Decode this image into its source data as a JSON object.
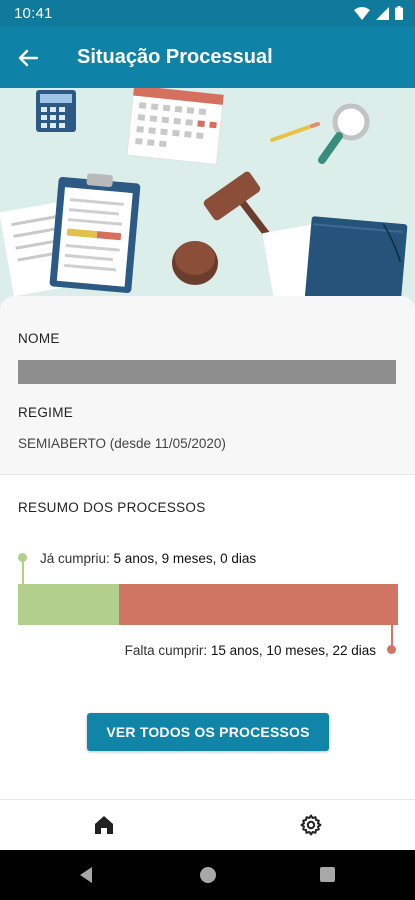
{
  "status_bar": {
    "time": "10:41"
  },
  "app_bar": {
    "title": "Situação Processual"
  },
  "colors": {
    "primary": "#0f82a8",
    "done": "#b3cf8c",
    "remaining": "#d07464"
  },
  "details": {
    "name_label": "NOME",
    "regime_label": "REGIME",
    "regime_value": "SEMIABERTO (desde 11/05/2020)"
  },
  "summary": {
    "title": "RESUMO DOS PROCESSOS",
    "served_label": "Já cumpriu:",
    "served_value": "5 anos, 9 meses, 0 dias",
    "remaining_label": "Falta cumprir:",
    "remaining_value": "15 anos, 10 meses, 22 dias",
    "served_fraction": 0.265
  },
  "action": {
    "view_all_label": "VER TODOS OS PROCESSOS"
  },
  "bottom_nav": {
    "items": [
      "home-icon",
      "gear-icon"
    ]
  }
}
